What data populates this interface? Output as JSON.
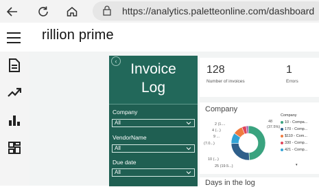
{
  "browser": {
    "url": "https://analytics.paletteonline.com/dashboard",
    "icons": [
      "back-arrow-icon",
      "reload-icon",
      "home-icon",
      "lock-icon"
    ]
  },
  "app": {
    "brand": "rillion prime"
  },
  "rail": {
    "icons": [
      "document-icon",
      "trend-icon",
      "bar-chart-icon",
      "dashboard-grid-icon"
    ]
  },
  "report": {
    "title_line1": "Invoice",
    "title_line2": "Log",
    "filters": [
      {
        "label": "Company",
        "value": "All"
      },
      {
        "label": "VendorName",
        "value": "All"
      },
      {
        "label": "Due date",
        "value": "All"
      }
    ],
    "kpis": [
      {
        "value": "128",
        "label": "Number of invoices"
      },
      {
        "value": "1",
        "label": "Errors"
      }
    ],
    "company_chart": {
      "title": "Company",
      "slice_labels": [
        "2 (1....",
        "4 (...)",
        "9 ...",
        "(7.0...)",
        "10 (...)",
        "25 (19.5...)"
      ],
      "callout": "48",
      "callout_pct": "(37.5%)",
      "legend_title": "Company",
      "legend": [
        "10 - Compa...",
        "170 - Comp...",
        "$110 - Com...",
        "330 - Comp...",
        "421 - Comp..."
      ],
      "legend_more": "▾"
    },
    "next_chart_title": "Days in the log"
  },
  "chart_data": {
    "type": "pie",
    "title": "Company",
    "values": [
      48,
      25,
      10,
      9,
      4,
      2
    ],
    "labels": [
      "48 (37.5%)",
      "25 (19.5...)",
      "10 (...)",
      "9 ...",
      "4 (...)",
      "2 (1...."
    ],
    "legend": [
      "10 - Compa...",
      "170 - Comp...",
      "$110 - Com...",
      "330 - Comp...",
      "421 - Comp..."
    ],
    "colors": [
      "#3aa37f",
      "#2f5f8a",
      "#33a3d6",
      "#f07b3f",
      "#e0445b",
      "#9b5fb0",
      "#f2c12e",
      "#8a8a8a",
      "#c46ab0",
      "#6fcf97"
    ]
  },
  "colors": {
    "accent": "#22685a",
    "panel": "#1f5f52",
    "canvas": "#f2f4f4"
  }
}
